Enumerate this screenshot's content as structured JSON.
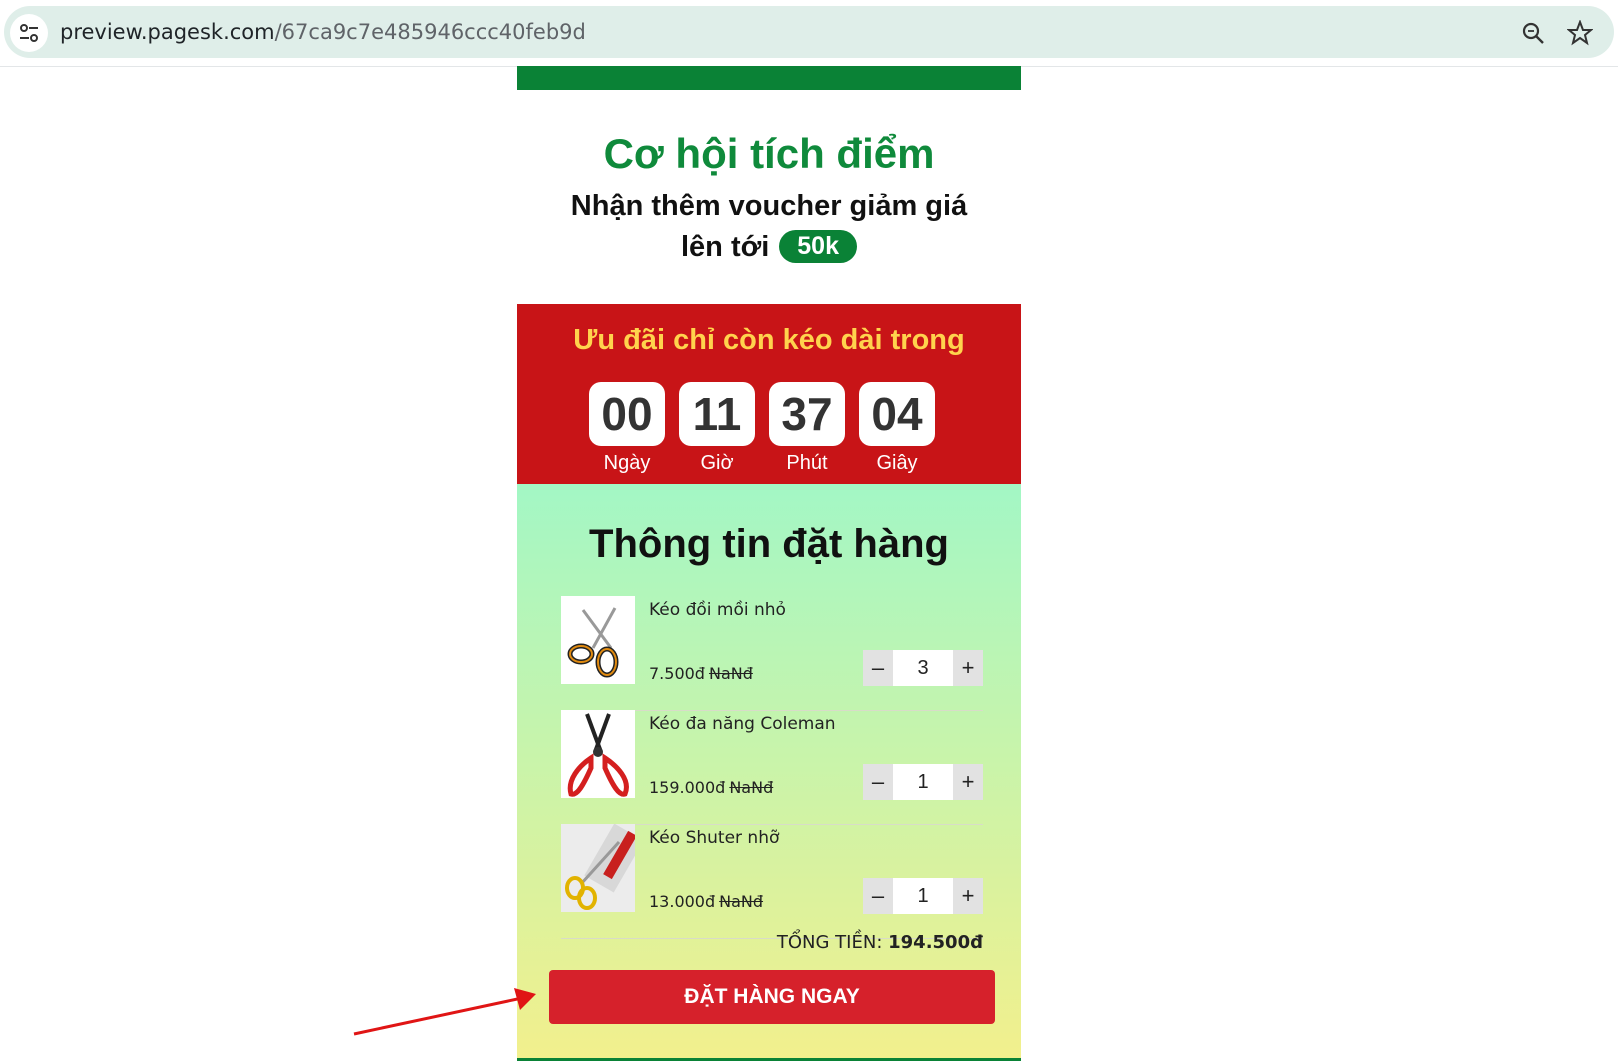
{
  "browser": {
    "url_host": "preview.pagesk.com",
    "url_path": "/67ca9c7e485946ccc40feb9d",
    "icons": [
      "site-settings-icon",
      "zoom-icon",
      "star-icon"
    ]
  },
  "promo": {
    "title": "Cơ hội tích điểm",
    "subtitle": "Nhận thêm voucher giảm giá",
    "line3_prefix": "lên tới",
    "badge": "50k"
  },
  "countdown": {
    "title": "Ưu đãi chỉ còn kéo dài trong",
    "units": [
      {
        "value": "00",
        "label": "Ngày"
      },
      {
        "value": "11",
        "label": "Giờ"
      },
      {
        "value": "37",
        "label": "Phút"
      },
      {
        "value": "04",
        "label": "Giây"
      }
    ]
  },
  "order": {
    "title": "Thông tin đặt hàng",
    "items": [
      {
        "name": "Kéo đồi mồi nhỏ",
        "price": "7.500đ",
        "old_price": "NaNđ",
        "qty": "3",
        "image": "small-scissors"
      },
      {
        "name": "Kéo đa năng Coleman",
        "price": "159.000đ",
        "old_price": "NaNđ",
        "qty": "1",
        "image": "multi-scissors"
      },
      {
        "name": "Kéo Shuter nhỡ",
        "price": "13.000đ",
        "old_price": "NaNđ",
        "qty": "1",
        "image": "packaged-scissors"
      }
    ],
    "minus_label": "–",
    "plus_label": "+",
    "total_label": "TỔNG TIỀN:",
    "total_value": "194.500đ",
    "submit_label": "ĐẶT HÀNG NGAY"
  },
  "colors": {
    "brand_green": "#0a8236",
    "countdown_red": "#c81417",
    "button_red": "#d6212b",
    "countdown_title": "#ffd34d"
  }
}
